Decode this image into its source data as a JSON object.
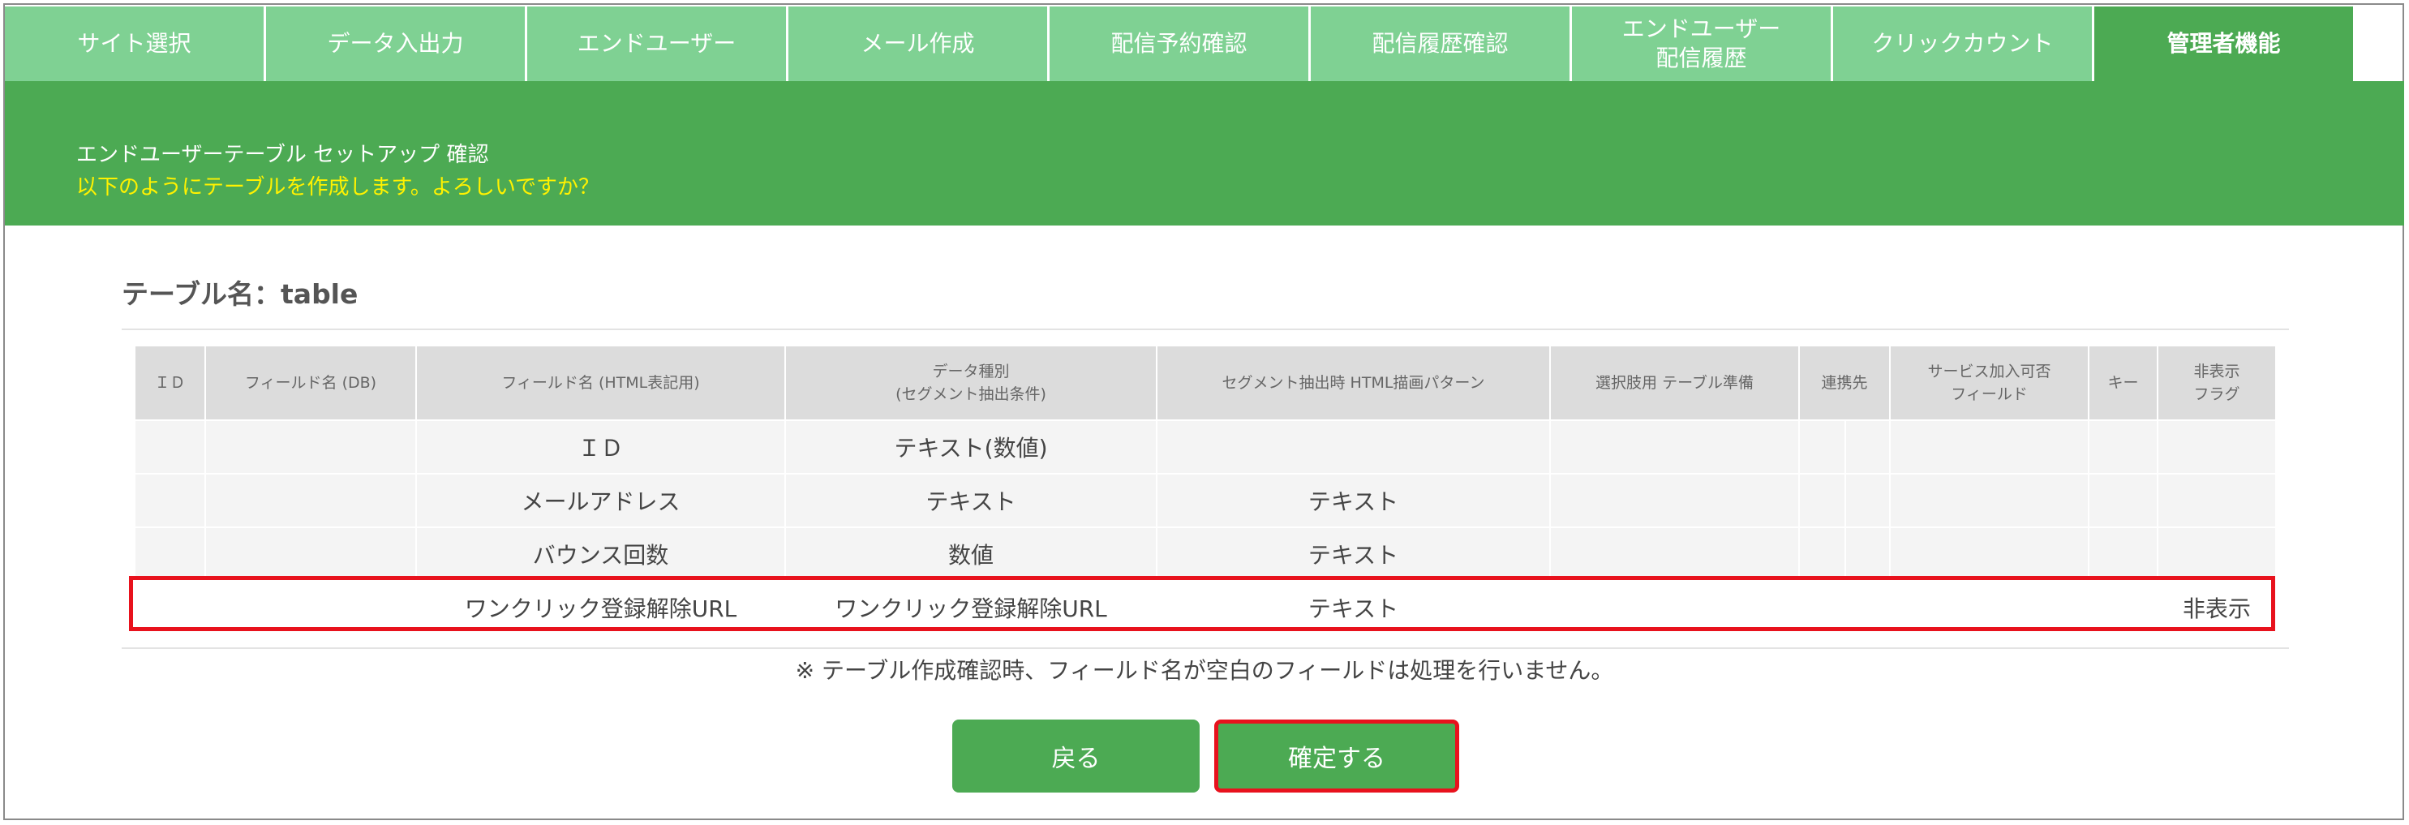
{
  "tabs": [
    {
      "label": "サイト選択"
    },
    {
      "label": "データ入出力"
    },
    {
      "label": "エンドユーザー"
    },
    {
      "label": "メール作成"
    },
    {
      "label": "配信予約確認"
    },
    {
      "label": "配信履歴確認"
    },
    {
      "label": "エンドユーザー\n配信履歴"
    },
    {
      "label": "クリックカウント"
    },
    {
      "label": "管理者機能"
    }
  ],
  "active_tab": "管理者機能",
  "header": {
    "title": "エンドユーザーテーブル セットアップ 確認",
    "subtitle": "以下のようにテーブルを作成します。よろしいですか？"
  },
  "table_name": "テーブル名：table",
  "columns": [
    "ＩＤ",
    "フィールド名 (DB)",
    "フィールド名 (HTML表記用)",
    "データ種別\n(セグメント抽出条件)",
    "セグメント抽出時 HTML描画パターン",
    "選択肢用 テーブル準備",
    "連携先",
    "サービス加入可否\nフィールド",
    "キー",
    "非表示\nフラグ"
  ],
  "rows": [
    {
      "id": "",
      "db": "",
      "html": "ＩＤ",
      "type": "テキスト(数値)",
      "pattern": "",
      "choice": "",
      "link_a": "",
      "link_b": "",
      "service": "",
      "key": "",
      "hidden": ""
    },
    {
      "id": "",
      "db": "",
      "html": "メールアドレス",
      "type": "テキスト",
      "pattern": "テキスト",
      "choice": "",
      "link_a": "",
      "link_b": "",
      "service": "",
      "key": "",
      "hidden": ""
    },
    {
      "id": "",
      "db": "",
      "html": "バウンス回数",
      "type": "数値",
      "pattern": "テキスト",
      "choice": "",
      "link_a": "",
      "link_b": "",
      "service": "",
      "key": "",
      "hidden": ""
    },
    {
      "id": "",
      "db": "",
      "html": "ワンクリック登録解除URL",
      "type": "ワンクリック登録解除URL",
      "pattern": "テキスト",
      "choice": "",
      "link_a": "",
      "link_b": "",
      "service": "",
      "key": "",
      "hidden": "非表示"
    }
  ],
  "note": "※ テーブル作成確認時、フィールド名が空白のフィールドは処理を行いません。",
  "buttons": {
    "back": "戻る",
    "confirm": "確定する"
  },
  "colors": {
    "tab_inactive": "#7fd193",
    "accent_green": "#4caa53",
    "subtitle_yellow": "#fff200",
    "highlight_red": "#e8121d"
  }
}
